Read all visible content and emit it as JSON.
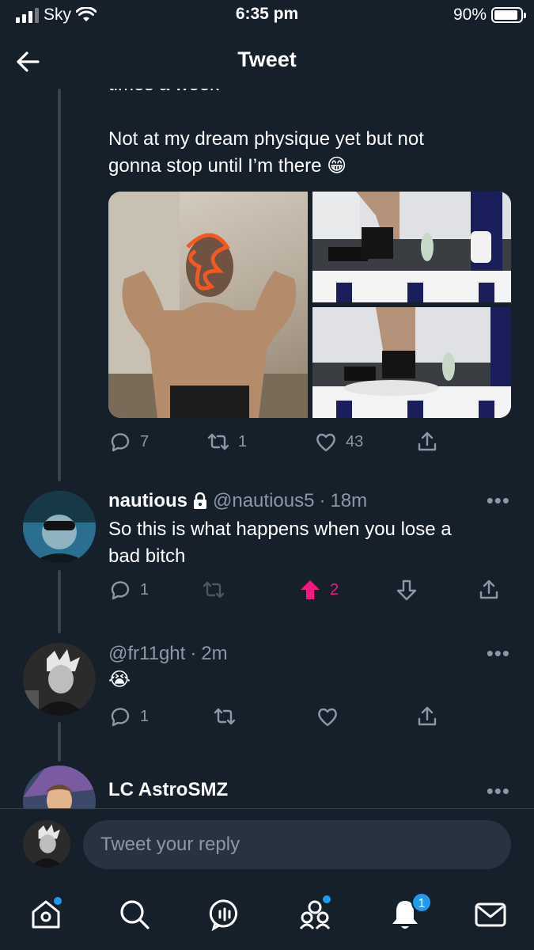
{
  "status": {
    "carrier": "Sky",
    "time": "6:35 pm",
    "battery": "90%",
    "battery_level": 0.9
  },
  "header": {
    "title": "Tweet"
  },
  "main_tweet": {
    "partial_line": "times a week",
    "text_lines": [
      "Not at my dream physique yet but not",
      "gonna stop until I’m there 😁"
    ],
    "replies": "7",
    "retweets": "1",
    "likes": "43"
  },
  "reply1": {
    "name": "nautious",
    "handle": "@nautious5",
    "time": "18m",
    "text_lines": [
      "So this is what happens when you lose a",
      "bad bitch"
    ],
    "replies": "1",
    "votes": "2"
  },
  "reply2": {
    "handle": "@fr11ght",
    "time": "2m",
    "text": "😭",
    "replies": "1"
  },
  "reply3": {
    "name": "LC AstroSMZ"
  },
  "compose": {
    "placeholder": "Tweet your reply"
  },
  "tabs": {
    "notifications_count": "1"
  },
  "colors": {
    "background": "#15202b",
    "muted": "#8b98a5",
    "accent": "#1d9bf0",
    "upvote": "#f91880"
  }
}
